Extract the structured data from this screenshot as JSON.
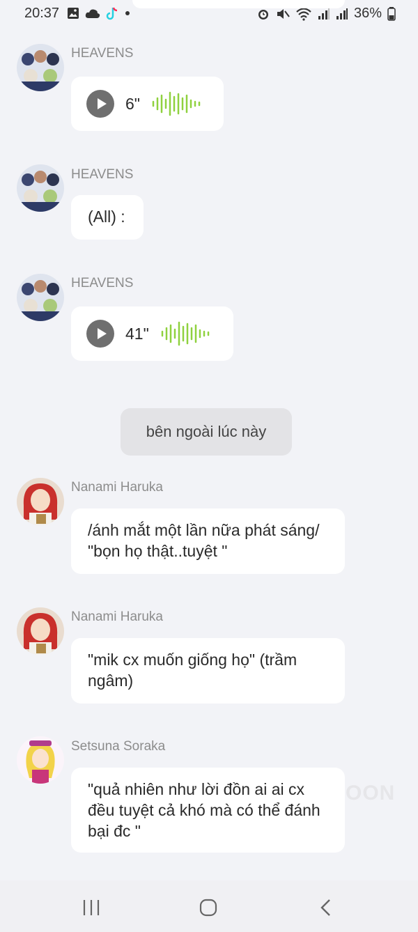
{
  "status_bar": {
    "time": "20:37",
    "battery": "36%",
    "left_icons": [
      "gallery-icon",
      "cloud-icon",
      "tiktok-icon",
      "dot-icon"
    ],
    "right_icons": [
      "alarm-icon",
      "mute-icon",
      "wifi-icon",
      "signal-icon",
      "signal-icon",
      "battery-icon"
    ]
  },
  "messages": [
    {
      "sender": "HEAVENS",
      "type": "voice",
      "duration": "6\""
    },
    {
      "sender": "HEAVENS",
      "type": "text",
      "text": "(All) :"
    },
    {
      "sender": "HEAVENS",
      "type": "voice",
      "duration": "41\""
    },
    {
      "type": "system",
      "text": "bên ngoài lúc này"
    },
    {
      "sender": "Nanami Haruka",
      "type": "text",
      "text": "/ánh mắt một lần nữa phát sáng/ \"bọn họ thật..tuyệt \""
    },
    {
      "sender": "Nanami Haruka",
      "type": "text",
      "text": "\"mik cx muốn giống họ\" (trầm ngâm)"
    },
    {
      "sender": "Setsuna Soraka",
      "type": "text",
      "text": "\"quả nhiên như lời đồn ai ai cx đều tuyệt cả khó mà có thể đánh bại đc \""
    }
  ],
  "watermark": "OON",
  "colors": {
    "background": "#f2f3f7",
    "bubble": "#ffffff",
    "waveform": "#8fd13f",
    "system_chip": "#e3e3e6"
  }
}
